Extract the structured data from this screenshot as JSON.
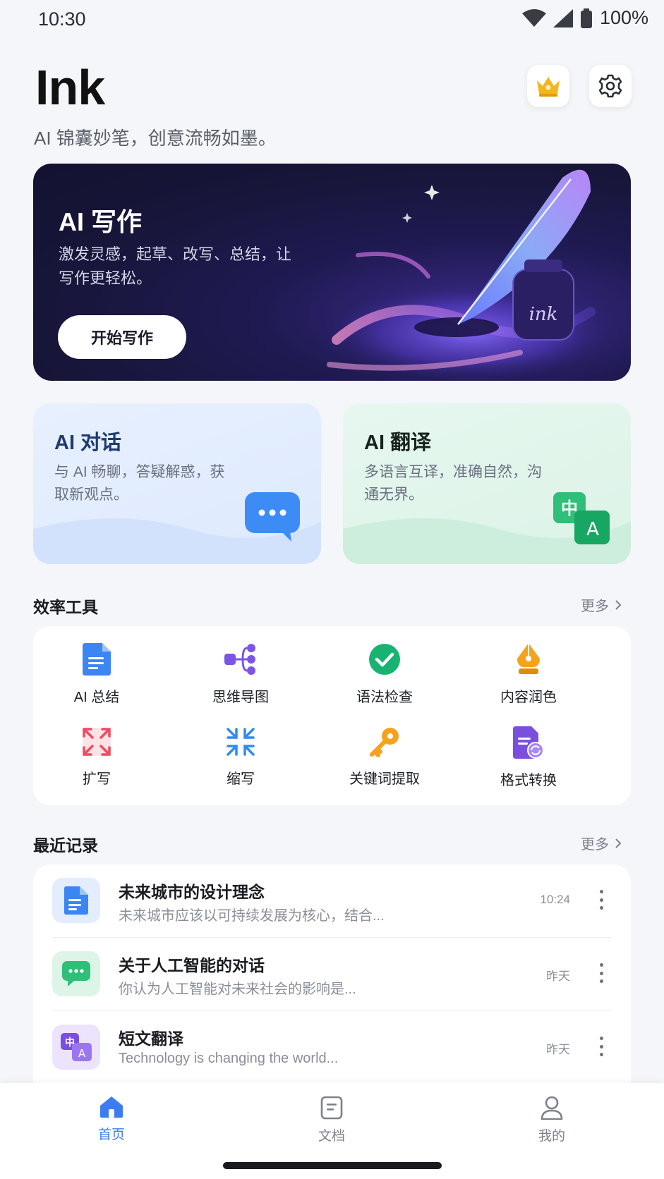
{
  "status_bar": {
    "time": "10:30",
    "battery": "100%"
  },
  "header": {
    "title": "Ink",
    "tagline": "AI 锦囊妙笔，创意流畅如墨。"
  },
  "hero": {
    "title": "AI 写作",
    "description": "激发灵感，起草、改写、总结，让写作更轻松。",
    "cta_label": "开始写作",
    "art_label": "ink"
  },
  "features": {
    "chat": {
      "title": "AI 对话",
      "description": "与 AI 畅聊，答疑解惑，获取新观点。"
    },
    "translate": {
      "title": "AI 翻译",
      "description": "多语言互译，准确自然，沟通无界。",
      "icon_zh": "中",
      "icon_en": "A"
    }
  },
  "tools": {
    "title": "效率工具",
    "more_label": "更多",
    "items": [
      {
        "label": "AI 总结",
        "icon": "document-icon"
      },
      {
        "label": "思维导图",
        "icon": "mindmap-icon"
      },
      {
        "label": "语法检查",
        "icon": "check-icon"
      },
      {
        "label": "内容润色",
        "icon": "pen-nib-icon"
      },
      {
        "label": "扩写",
        "icon": "expand-icon"
      },
      {
        "label": "缩写",
        "icon": "compress-icon"
      },
      {
        "label": "关键词提取",
        "icon": "key-icon"
      },
      {
        "label": "格式转换",
        "icon": "convert-icon"
      }
    ]
  },
  "recent": {
    "title": "最近记录",
    "more_label": "更多",
    "items": [
      {
        "title": "未来城市的设计理念",
        "subtitle": "未来城市应该以可持续发展为核心，结合...",
        "time": "10:24",
        "icon": "document-icon"
      },
      {
        "title": "关于人工智能的对话",
        "subtitle": "你认为人工智能对未来社会的影响是...",
        "time": "昨天",
        "icon": "chat-icon"
      },
      {
        "title": "短文翻译",
        "subtitle": "Technology is changing the world...",
        "time": "昨天",
        "icon": "translate-icon"
      }
    ]
  },
  "nav": {
    "items": [
      {
        "label": "首页",
        "active": true
      },
      {
        "label": "文档",
        "active": false
      },
      {
        "label": "我的",
        "active": false
      }
    ]
  },
  "colors": {
    "accent": "#3d7cf0",
    "nav_inactive": "#7d818c"
  }
}
